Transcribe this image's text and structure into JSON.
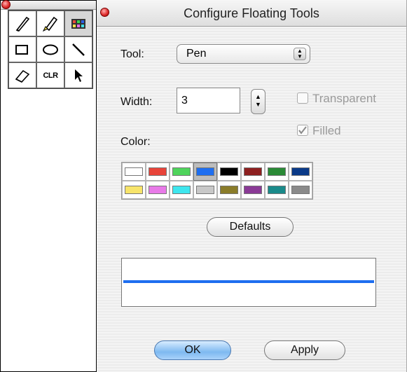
{
  "palette": {
    "tools": [
      {
        "name": "pen-tool",
        "icon": "pen-icon",
        "selected": false
      },
      {
        "name": "highlighter-tool",
        "icon": "highlighter-icon",
        "selected": false
      },
      {
        "name": "color-tool",
        "icon": "color-grid-icon",
        "selected": true
      },
      {
        "name": "rectangle-tool",
        "icon": "rectangle-icon",
        "selected": false
      },
      {
        "name": "ellipse-tool",
        "icon": "ellipse-icon",
        "selected": false
      },
      {
        "name": "line-tool",
        "icon": "line-icon",
        "selected": false
      },
      {
        "name": "eraser-tool",
        "icon": "eraser-icon",
        "selected": false
      },
      {
        "name": "clear-tool",
        "icon": "clr-icon",
        "label": "CLR",
        "selected": false
      },
      {
        "name": "arrow-tool",
        "icon": "arrow-pointer-icon",
        "selected": false
      }
    ]
  },
  "dialog": {
    "title": "Configure Floating Tools",
    "tool_label": "Tool:",
    "tool_value": "Pen",
    "width_label": "Width:",
    "width_value": "3",
    "transparent_label": "Transparent",
    "transparent_checked": false,
    "filled_label": "Filled",
    "filled_checked": true,
    "color_label": "Color:",
    "colors": [
      "#ffffff",
      "#e8443a",
      "#4fd45c",
      "#1e6ef0",
      "#000000",
      "#8e2020",
      "#2a8a36",
      "#0a3a88",
      "#f7e46a",
      "#e87ae8",
      "#3ee6ee",
      "#c8c8c8",
      "#8a7c2a",
      "#8a3a96",
      "#1a8a8a",
      "#8a8a8a"
    ],
    "selected_color_index": 3,
    "defaults_label": "Defaults",
    "preview_color": "#1e6ef0",
    "ok_label": "OK",
    "apply_label": "Apply"
  }
}
